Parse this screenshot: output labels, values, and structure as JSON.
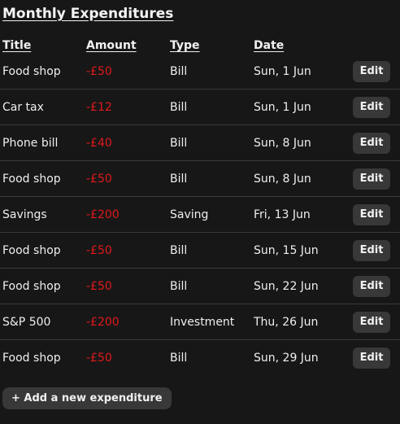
{
  "page": {
    "title": "Monthly Expenditures"
  },
  "table": {
    "headers": {
      "title": "Title",
      "amount": "Amount",
      "type": "Type",
      "date": "Date"
    },
    "rows": [
      {
        "title": "Food shop",
        "amount": "-£50",
        "type": "Bill",
        "date": "Sun, 1 Jun",
        "action": "Edit"
      },
      {
        "title": "Car tax",
        "amount": "-£12",
        "type": "Bill",
        "date": "Sun, 1 Jun",
        "action": "Edit"
      },
      {
        "title": "Phone bill",
        "amount": "-£40",
        "type": "Bill",
        "date": "Sun, 8 Jun",
        "action": "Edit"
      },
      {
        "title": "Food shop",
        "amount": "-£50",
        "type": "Bill",
        "date": "Sun, 8 Jun",
        "action": "Edit"
      },
      {
        "title": "Savings",
        "amount": "-£200",
        "type": "Saving",
        "date": "Fri, 13 Jun",
        "action": "Edit"
      },
      {
        "title": "Food shop",
        "amount": "-£50",
        "type": "Bill",
        "date": "Sun, 15 Jun",
        "action": "Edit"
      },
      {
        "title": "Food shop",
        "amount": "-£50",
        "type": "Bill",
        "date": "Sun, 22 Jun",
        "action": "Edit"
      },
      {
        "title": "S&P 500",
        "amount": "-£200",
        "type": "Investment",
        "date": "Thu, 26 Jun",
        "action": "Edit"
      },
      {
        "title": "Food shop",
        "amount": "-£50",
        "type": "Bill",
        "date": "Sun, 29 Jun",
        "action": "Edit"
      }
    ]
  },
  "actions": {
    "add_label": "+ Add a new expenditure"
  },
  "colors": {
    "background": "#181717",
    "negative_amount": "#e0191b",
    "button_bg": "#383838",
    "divider": "#3a3a3a"
  }
}
